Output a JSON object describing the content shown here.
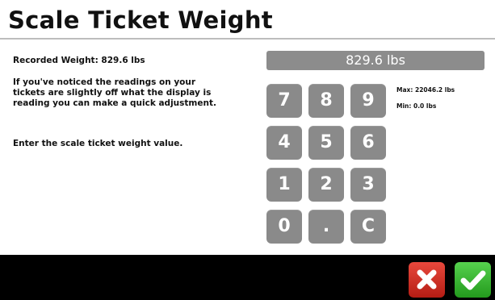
{
  "title": "Scale Ticket Weight",
  "recorded_weight": "Recorded Weight: 829.6 lbs",
  "notice_lines": [
    "If you've noticed the readings on your",
    "tickets are slightly off what the display is",
    "reading you can make a quick adjustment."
  ],
  "instruction": "Enter the scale ticket weight value.",
  "display_value": "829.6 lbs",
  "max_label": "Max: 22046.2 lbs",
  "min_label": "Min: 0.0 lbs",
  "keypad": {
    "keys": [
      "7",
      "8",
      "9",
      "4",
      "5",
      "6",
      "1",
      "2",
      "3",
      "0",
      ".",
      "C"
    ]
  },
  "buttons": {
    "cancel_icon": "x-icon",
    "confirm_icon": "checkmark-icon",
    "cancel_color": "#d9342a",
    "confirm_color": "#3dbb35"
  }
}
